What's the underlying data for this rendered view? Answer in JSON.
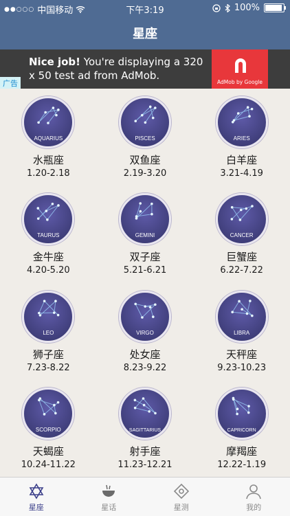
{
  "status": {
    "carrier": "中国移动",
    "time": "下午3:19",
    "battery": "100%"
  },
  "nav": {
    "title": "星座"
  },
  "ad": {
    "badge": "广告",
    "headline": "Nice job!",
    "body": " You're displaying a 320 x 50 test ad from AdMob.",
    "brand": "AdMob by Google"
  },
  "signs": [
    {
      "en": "AQUARIUS",
      "name": "水瓶座",
      "date": "1.20-2.18"
    },
    {
      "en": "PISCES",
      "name": "双鱼座",
      "date": "2.19-3.20"
    },
    {
      "en": "ARIES",
      "name": "白羊座",
      "date": "3.21-4.19"
    },
    {
      "en": "TAURUS",
      "name": "金牛座",
      "date": "4.20-5.20"
    },
    {
      "en": "GEMINI",
      "name": "双子座",
      "date": "5.21-6.21"
    },
    {
      "en": "CANCER",
      "name": "巨蟹座",
      "date": "6.22-7.22"
    },
    {
      "en": "LEO",
      "name": "狮子座",
      "date": "7.23-8.22"
    },
    {
      "en": "VIRGO",
      "name": "处女座",
      "date": "8.23-9.22"
    },
    {
      "en": "LIBRA",
      "name": "天秤座",
      "date": "9.23-10.23"
    },
    {
      "en": "SCORPIO",
      "name": "天蝎座",
      "date": "10.24-11.22"
    },
    {
      "en": "SAGITTARIUS",
      "name": "射手座",
      "date": "11.23-12.21"
    },
    {
      "en": "CAPRICORN",
      "name": "摩羯座",
      "date": "12.22-1.19"
    }
  ],
  "tabs": [
    {
      "label": "星座",
      "icon": "star-of-david-icon",
      "active": true
    },
    {
      "label": "星话",
      "icon": "bowl-icon",
      "active": false
    },
    {
      "label": "星测",
      "icon": "diamond-target-icon",
      "active": false
    },
    {
      "label": "我的",
      "icon": "person-icon",
      "active": false
    }
  ],
  "colors": {
    "bar": "#4f6b93",
    "active_tab": "#3b3f8a",
    "circle_dark": "#343469",
    "circle_light": "#5e5aa8"
  }
}
